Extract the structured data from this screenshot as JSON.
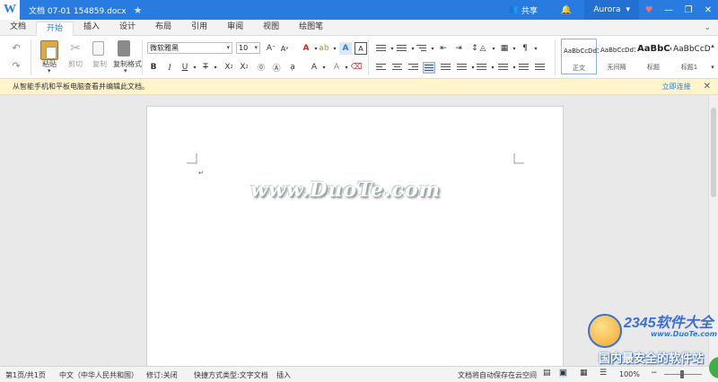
{
  "titlebar": {
    "logo": "W",
    "doc_title": "文档 07-01 154859.docx",
    "share_label": "共享",
    "user_name": "Aurora",
    "accent": "#2a7be0"
  },
  "menu": {
    "tabs": [
      "文档",
      "开始",
      "插入",
      "设计",
      "布局",
      "引用",
      "审阅",
      "视图",
      "绘图笔"
    ],
    "active_tab": "开始"
  },
  "ribbon": {
    "paste_label": "粘贴",
    "cut_label": "剪切",
    "copy_label": "复制",
    "format_painter_label": "复制格式",
    "font_name": "微软雅黑",
    "font_size": "10",
    "styles": [
      {
        "sample": "AaBbCcDd1",
        "name": "正文"
      },
      {
        "sample": "AaBbCcDd1",
        "name": "无间隔"
      },
      {
        "sample": "AaBbCc",
        "name": "标题"
      },
      {
        "sample": "AaBbCcD",
        "name": "标题1"
      }
    ]
  },
  "notice": {
    "text": "从智能手机和平板电脑查看并编辑此文档。",
    "link": "立即连接",
    "bg": "#fff4cc"
  },
  "document": {
    "watermark": "www.DuoTe.com"
  },
  "badge": {
    "title": "2345软件大全",
    "url": "www.DuoTe.com",
    "subtitle": "国内最安全的软件站"
  },
  "status": {
    "page": "第1页/共1页",
    "language": "中文（中华人民共和国）",
    "revision": "修订:关闭",
    "shortcut": "快捷方式类型:文字文档",
    "insert_mode": "插入",
    "save_status": "文档将自动保存在云空间",
    "zoom": "100%"
  }
}
